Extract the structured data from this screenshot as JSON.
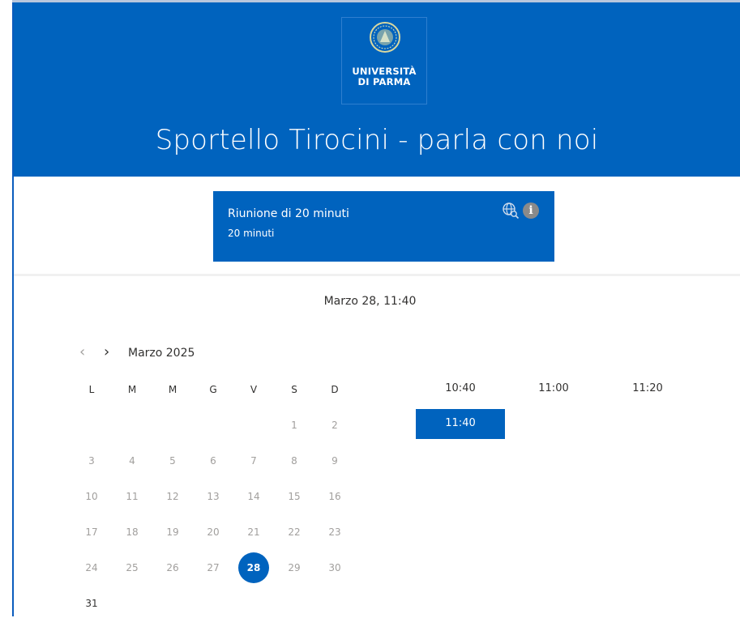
{
  "header": {
    "logo_line1": "UNIVERSITÀ",
    "logo_line2": "DI PARMA",
    "title": "Sportello Tirocini - parla con noi",
    "bg_color": "#0063be"
  },
  "service": {
    "name": "Riunione di 20 minuti",
    "duration": "20 minuti",
    "icons": [
      "globe-search-icon",
      "info-icon"
    ]
  },
  "selection": {
    "label": "Marzo 28, 11:40"
  },
  "calendar": {
    "month_label": "Marzo 2025",
    "weekdays": [
      "L",
      "M",
      "M",
      "G",
      "V",
      "S",
      "D"
    ],
    "weeks": [
      [
        "",
        "",
        "",
        "",
        "",
        "1",
        "2"
      ],
      [
        "3",
        "4",
        "5",
        "6",
        "7",
        "8",
        "9"
      ],
      [
        "10",
        "11",
        "12",
        "13",
        "14",
        "15",
        "16"
      ],
      [
        "17",
        "18",
        "19",
        "20",
        "21",
        "22",
        "23"
      ],
      [
        "24",
        "25",
        "26",
        "27",
        "28",
        "29",
        "30"
      ],
      [
        "31",
        "",
        "",
        "",
        "",
        "",
        ""
      ]
    ],
    "selected_day": "28",
    "available_days": [
      "28",
      "31"
    ]
  },
  "time_slots": {
    "row1": [
      "10:40",
      "11:00",
      "11:20"
    ],
    "row2": [
      "11:40"
    ],
    "selected": "11:40"
  }
}
